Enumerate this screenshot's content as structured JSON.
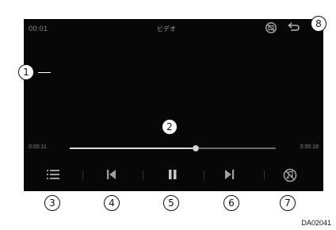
{
  "header": {
    "elapsed_top": "00:01",
    "title": "ビデオ",
    "no_display_icon": "no-display-icon",
    "back_icon": "back-arrow-icon"
  },
  "seek": {
    "elapsed": "0:00:11",
    "total": "0:00:18",
    "progress": 0.61
  },
  "controls": [
    {
      "name": "list-button",
      "icon": "list-icon"
    },
    {
      "name": "previous-button",
      "icon": "skip-previous-icon"
    },
    {
      "name": "pause-button",
      "icon": "pause-icon"
    },
    {
      "name": "next-button",
      "icon": "skip-next-icon"
    },
    {
      "name": "audio-off-button",
      "icon": "sound-off-icon"
    }
  ],
  "callouts": [
    "1",
    "2",
    "3",
    "4",
    "5",
    "6",
    "7",
    "8"
  ],
  "drawing_code": "DA02041"
}
